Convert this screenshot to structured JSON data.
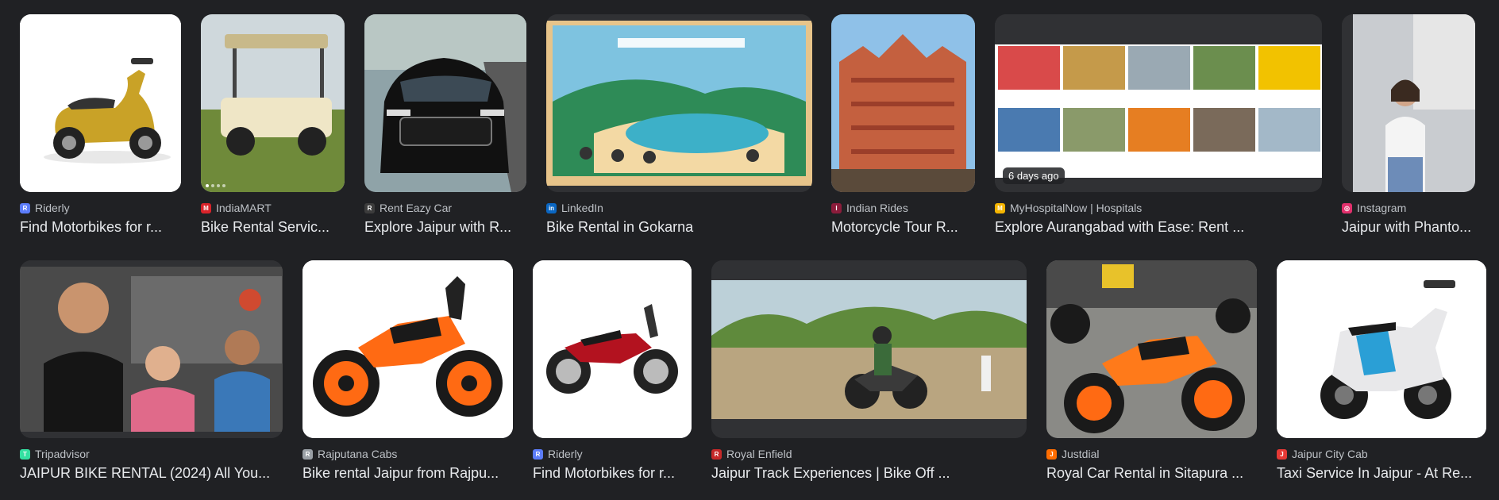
{
  "results": [
    {
      "source": "Riderly",
      "title": "Find Motorbikes for r...",
      "favicon": "riderly-icon",
      "favicon_color": "#5b7cfa"
    },
    {
      "source": "IndiaMART",
      "title": "Bike Rental Servic...",
      "favicon": "indiamart-icon",
      "favicon_color": "#d8232a"
    },
    {
      "source": "Rent Eazy Car",
      "title": "Explore Jaipur with R...",
      "favicon": "renteazy-icon",
      "favicon_color": "#3c3c3c"
    },
    {
      "source": "LinkedIn",
      "title": "Bike Rental in Gokarna",
      "favicon": "linkedin-icon",
      "favicon_color": "#0a66c2"
    },
    {
      "source": "Indian Rides",
      "title": "Motorcycle Tour R...",
      "favicon": "indianrides-icon",
      "favicon_color": "#8b1c3b"
    },
    {
      "source": "MyHospitalNow | Hospitals",
      "title": "Explore Aurangabad with Ease: Rent ...",
      "favicon": "myhospitalnow-icon",
      "favicon_color": "#f4b400",
      "badge": "6 days ago"
    },
    {
      "source": "Instagram",
      "title": "Jaipur with Phanto...",
      "favicon": "instagram-icon",
      "favicon_color": "#e1306c"
    },
    {
      "source": "Tripadvisor",
      "title": "JAIPUR BIKE RENTAL (2024) All You...",
      "favicon": "tripadvisor-icon",
      "favicon_color": "#34e0a1"
    },
    {
      "source": "Rajputana Cabs",
      "title": "Bike rental Jaipur from Rajpu...",
      "favicon": "rajputanacabs-icon",
      "favicon_color": "#9aa0a6"
    },
    {
      "source": "Riderly",
      "title": "Find Motorbikes for r...",
      "favicon": "riderly-icon",
      "favicon_color": "#5b7cfa"
    },
    {
      "source": "Royal Enfield",
      "title": "Jaipur Track Experiences | Bike Off ...",
      "favicon": "royalenfield-icon",
      "favicon_color": "#c62828"
    },
    {
      "source": "Justdial",
      "title": "Royal Car Rental in Sitapura ...",
      "favicon": "justdial-icon",
      "favicon_color": "#ff6d00"
    },
    {
      "source": "Jaipur City Cab",
      "title": "Taxi Service In Jaipur - At Re...",
      "favicon": "jaipurcitycab-icon",
      "favicon_color": "#e53935"
    }
  ]
}
